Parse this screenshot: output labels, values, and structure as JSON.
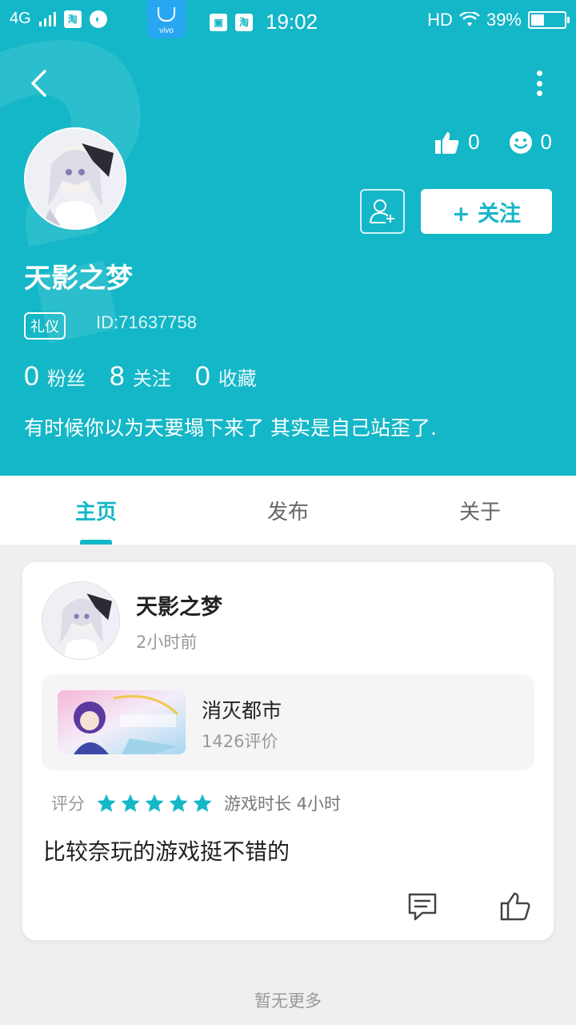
{
  "status_bar": {
    "network": "4G",
    "app_icon_1": "淘",
    "app_icon_2": "淘",
    "vivo_label": "vivo",
    "time": "19:02",
    "hd": "HD",
    "battery_percent": "39%",
    "battery_level": 0.39
  },
  "header": {
    "nickname": "天影之梦",
    "badge": "礼仪",
    "user_id": "ID:71637758",
    "likes": "0",
    "smiles": "0",
    "follow_label": "+ 关注",
    "counts": [
      {
        "num": "0",
        "label": "粉丝"
      },
      {
        "num": "8",
        "label": "关注"
      },
      {
        "num": "0",
        "label": "收藏"
      }
    ],
    "bio": "有时候你以为天要塌下来了 其实是自己站歪了."
  },
  "tabs": [
    {
      "label": "主页",
      "active": true
    },
    {
      "label": "发布",
      "active": false
    },
    {
      "label": "关于",
      "active": false
    }
  ],
  "post": {
    "author": "天影之梦",
    "time": "2小时前",
    "game_name": "消灭都市",
    "game_reviews": "1426评价",
    "rating_label": "评分",
    "stars": 5,
    "playtime": "游戏时长 4小时",
    "text": "比较奈玩的游戏挺不错的"
  },
  "footer": {
    "no_more": "暂无更多"
  },
  "colors": {
    "accent": "#14b7c7"
  }
}
